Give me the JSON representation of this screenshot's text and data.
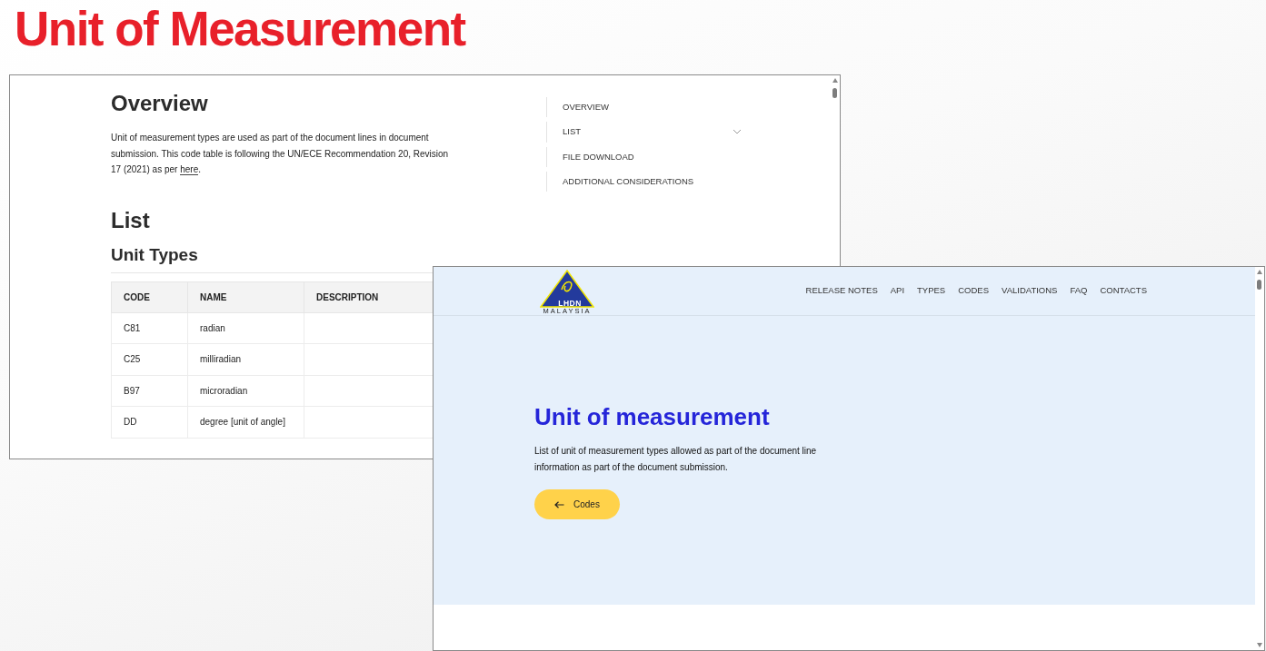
{
  "slide": {
    "title": "Unit of Measurement"
  },
  "docs_page": {
    "overview": {
      "heading": "Overview",
      "text_before": "Unit of measurement types are used as part of the document lines in document submission. This code table is following the UN/ECE Recommendation 20, Revision 17 (2021) as per ",
      "link": "here",
      "text_after": "."
    },
    "list_heading": "List",
    "table_heading": "Unit Types",
    "table": {
      "columns": [
        "CODE",
        "NAME",
        "DESCRIPTION"
      ],
      "rows": [
        {
          "code": "C81",
          "name": "radian"
        },
        {
          "code": "C25",
          "name": "milliradian"
        },
        {
          "code": "B97",
          "name": "microradian"
        },
        {
          "code": "DD",
          "name": "degree [unit of angle]"
        }
      ]
    },
    "toc": [
      {
        "label": "OVERVIEW",
        "expandable": false
      },
      {
        "label": "LIST",
        "expandable": true
      },
      {
        "label": "FILE DOWNLOAD",
        "expandable": false
      },
      {
        "label": "ADDITIONAL CONSIDERATIONS",
        "expandable": false
      }
    ]
  },
  "site_page": {
    "logo": {
      "name": "LHDN",
      "subtitle": "MALAYSIA"
    },
    "nav": [
      "RELEASE NOTES",
      "API",
      "TYPES",
      "CODES",
      "VALIDATIONS",
      "FAQ",
      "CONTACTS"
    ],
    "hero": {
      "title": "Unit of measurement",
      "text": "List of unit of measurement types allowed as part of the document line information as part of the document submission.",
      "back_button": "Codes"
    }
  }
}
